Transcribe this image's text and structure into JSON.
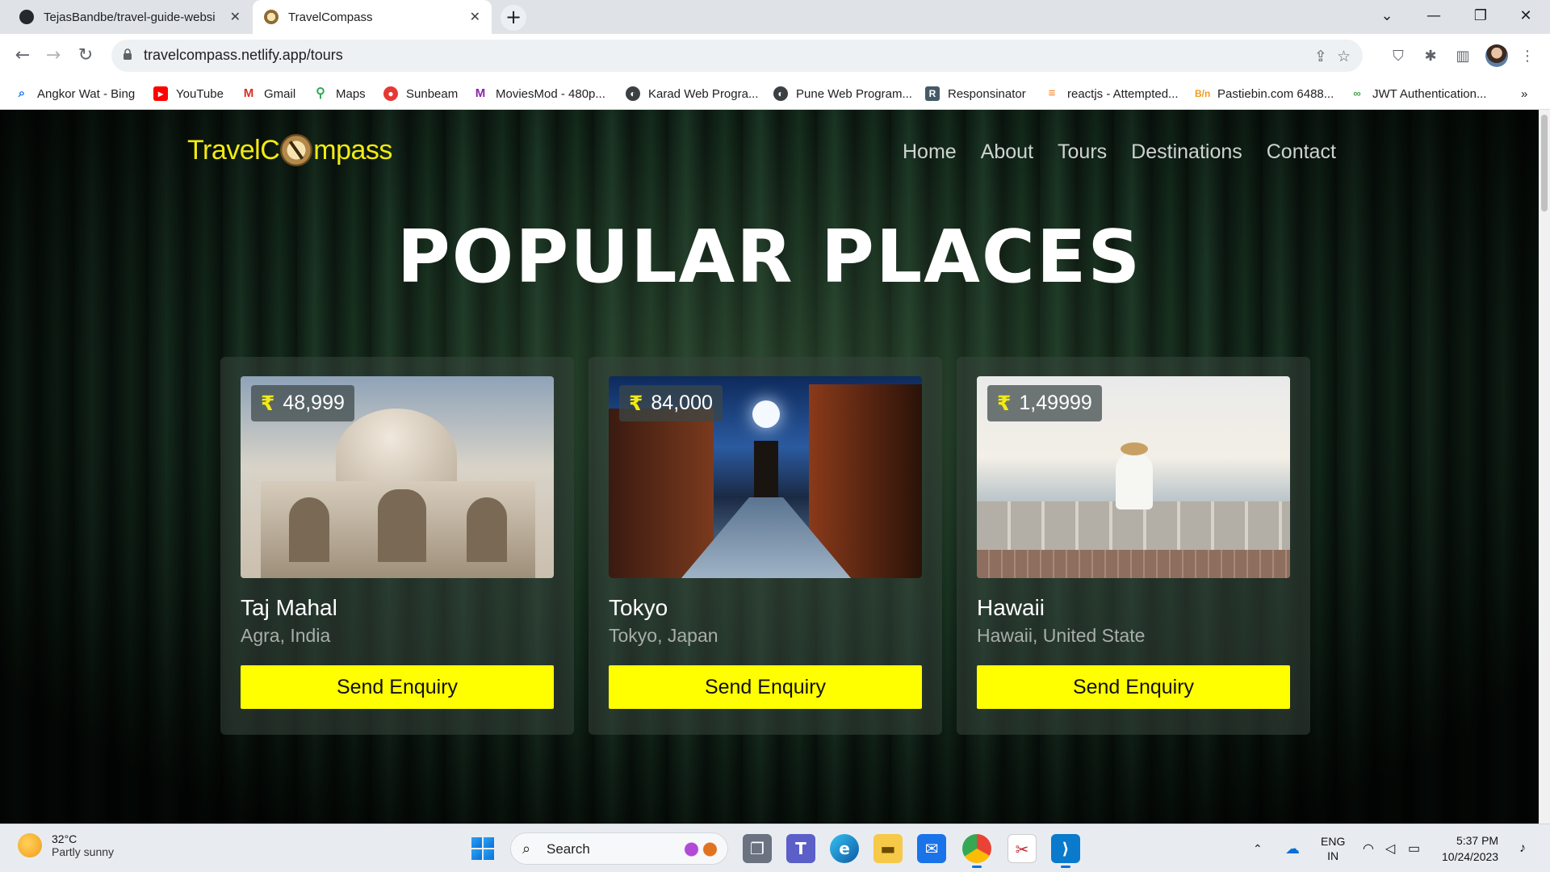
{
  "browser": {
    "tabs": [
      {
        "title": "TejasBandbe/travel-guide-websi",
        "active": false,
        "favicon": "github-icon"
      },
      {
        "title": "TravelCompass",
        "active": true,
        "favicon": "compass-icon"
      }
    ],
    "url": "travelcompass.netlify.app/tours",
    "bookmarks": [
      {
        "label": "Angkor Wat - Bing",
        "icon": "bing-search-icon"
      },
      {
        "label": "YouTube",
        "icon": "youtube-icon"
      },
      {
        "label": "Gmail",
        "icon": "gmail-icon"
      },
      {
        "label": "Maps",
        "icon": "maps-icon"
      },
      {
        "label": "Sunbeam",
        "icon": "sunbeam-icon"
      },
      {
        "label": "MoviesMod - 480p...",
        "icon": "moviesmod-icon"
      },
      {
        "label": "Karad Web Progra...",
        "icon": "globe-icon"
      },
      {
        "label": "Pune Web Program...",
        "icon": "globe-icon"
      },
      {
        "label": "Responsinator",
        "icon": "responsinator-icon"
      },
      {
        "label": "reactjs - Attempted...",
        "icon": "stackoverflow-icon"
      },
      {
        "label": "Pastiebin.com 6488...",
        "icon": "pastiebin-icon"
      },
      {
        "label": "JWT Authentication...",
        "icon": "jwt-icon"
      }
    ]
  },
  "site": {
    "logo": {
      "before": "TravelC",
      "after": "mpass"
    },
    "nav": [
      "Home",
      "About",
      "Tours",
      "Destinations",
      "Contact"
    ],
    "headline": "POPULAR PLACES",
    "currency_symbol": "₹",
    "enquiry_label": "Send Enquiry",
    "accent_color": "#ffff00",
    "logo_color": "#f3ea12",
    "tours": [
      {
        "price": "48,999",
        "name": "Taj Mahal",
        "location": "Agra, India"
      },
      {
        "price": "84,000",
        "name": "Tokyo",
        "location": "Tokyo, Japan"
      },
      {
        "price": "1,49999",
        "name": "Hawaii",
        "location": "Hawaii, United State"
      }
    ]
  },
  "taskbar": {
    "weather": {
      "temp": "32°C",
      "condition": "Partly sunny"
    },
    "search_label": "Search",
    "lang": {
      "line1": "ENG",
      "line2": "IN"
    },
    "time": "5:37 PM",
    "date": "10/24/2023"
  }
}
